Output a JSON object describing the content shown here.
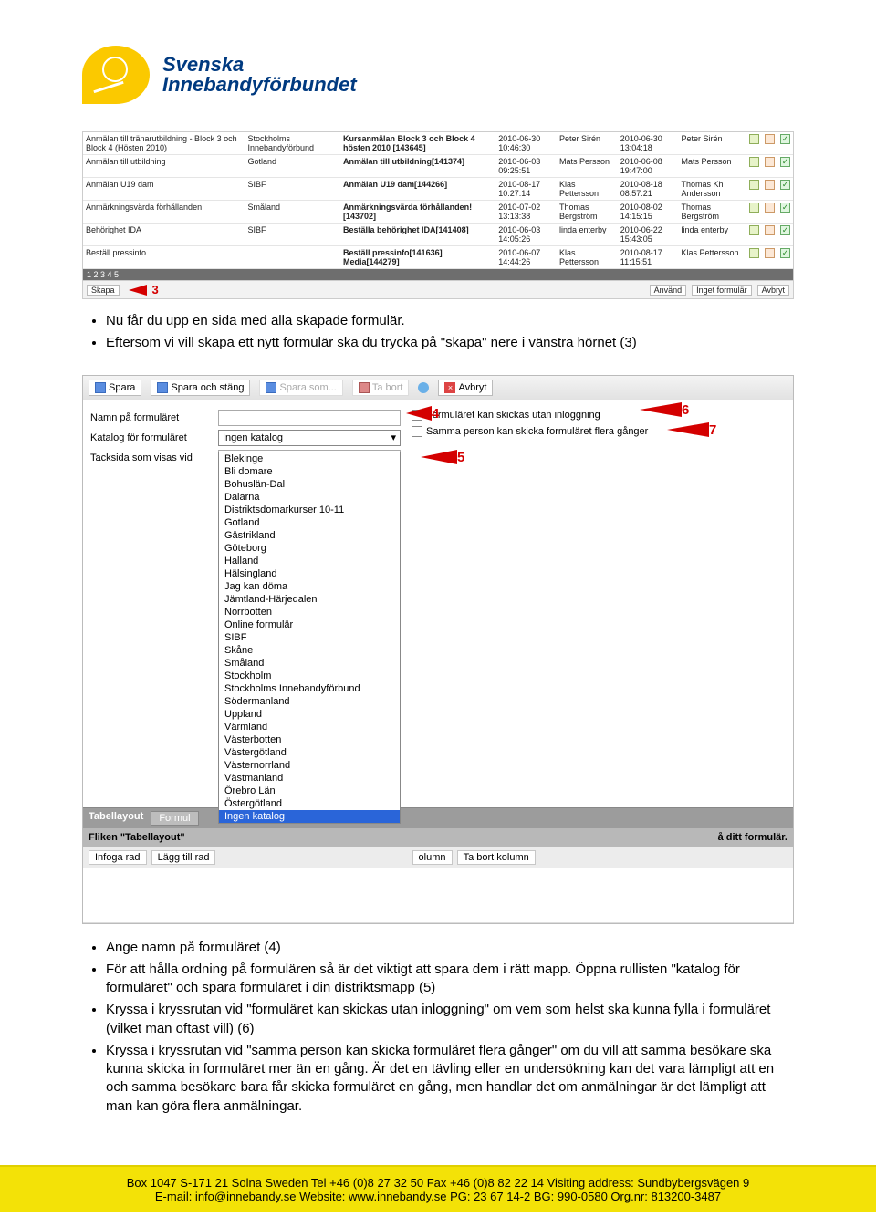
{
  "logo": {
    "line1": "Svenska",
    "line2": "Innebandyförbundet"
  },
  "table": {
    "rows": [
      {
        "c0": "Anmälan till tränarutbildning - Block 3 och Block 4 (Hösten 2010)",
        "c1": "Stockholms Innebandyförbund",
        "c2": "Kursanmälan Block 3 och Block 4 hösten 2010 [143645]",
        "c3": "2010-06-30 10:46:30",
        "c4": "Peter Sirén",
        "c5": "2010-06-30 13:04:18",
        "c6": "Peter Sirén"
      },
      {
        "c0": "Anmälan till utbildning",
        "c1": "Gotland",
        "c2": "Anmälan till utbildning[141374]",
        "c3": "2010-06-03 09:25:51",
        "c4": "Mats Persson",
        "c5": "2010-06-08 19:47:00",
        "c6": "Mats Persson"
      },
      {
        "c0": "Anmälan U19 dam",
        "c1": "SIBF",
        "c2": "Anmälan U19 dam[144266]",
        "c3": "2010-08-17 10:27:14",
        "c4": "Klas Pettersson",
        "c5": "2010-08-18 08:57:21",
        "c6": "Thomas Kh Andersson"
      },
      {
        "c0": "Anmärkningsvärda förhållanden",
        "c1": "Småland",
        "c2": "Anmärkningsvärda förhållanden![143702]",
        "c3": "2010-07-02 13:13:38",
        "c4": "Thomas Bergström",
        "c5": "2010-08-02 14:15:15",
        "c6": "Thomas Bergström"
      },
      {
        "c0": "Behörighet IDA",
        "c1": "SIBF",
        "c2": "Beställa behörighet IDA[141408]",
        "c3": "2010-06-03 14:05:26",
        "c4": "linda enterby",
        "c5": "2010-06-22 15:43:05",
        "c6": "linda enterby"
      },
      {
        "c0": "Beställ pressinfo",
        "c1": "",
        "c2": "Beställ pressinfo[141636] Media[144279]",
        "c3": "2010-06-07 14:44:26",
        "c4": "Klas Pettersson",
        "c5": "2010-08-17 11:15:51",
        "c6": "Klas Pettersson"
      }
    ],
    "pager": "1 2 3 4 5",
    "footer_left": "Skapa",
    "footer_right_use": "Använd",
    "footer_right_no": "Inget formulär",
    "footer_right_cancel": "Avbryt"
  },
  "ann3": "3",
  "bullets1": {
    "i0": "Nu får du upp en sida med alla skapade formulär.",
    "i1": "Eftersom vi vill skapa ett nytt formulär ska du trycka på \"skapa\" nere i vänstra hörnet (3)"
  },
  "toolbar": {
    "save": "Spara",
    "save_close": "Spara och stäng",
    "save_as": "Spara som...",
    "delete": "Ta bort",
    "cancel": "Avbryt"
  },
  "form": {
    "name_lbl": "Namn på formuläret",
    "folder_lbl": "Katalog för formuläret",
    "thanks_lbl": "Tacksida som visas vid",
    "folder_val": "Ingen katalog",
    "chk1": "Formuläret kan skickas utan inloggning",
    "chk2": "Samma person kan skicka formuläret flera gånger"
  },
  "ann4": "4",
  "ann5": "5",
  "ann6": "6",
  "ann7": "7",
  "dropdown": [
    "Blekinge",
    "Bli domare",
    "Bohuslän-Dal",
    "Dalarna",
    "Distriktsdomarkurser 10-11",
    "Gotland",
    "Gästrikland",
    "Göteborg",
    "Halland",
    "Hälsingland",
    "Jag kan döma",
    "Jämtland-Härjedalen",
    "Norrbotten",
    "Online formulär",
    "SIBF",
    "Skåne",
    "Småland",
    "Stockholm",
    "Stockholms Innebandyförbund",
    "Södermanland",
    "Uppland",
    "Värmland",
    "Västerbotten",
    "Västergötland",
    "Västernorrland",
    "Västmanland",
    "Örebro Län",
    "Östergötland",
    "Ingen katalog"
  ],
  "tabs": {
    "label": "Tabellayout",
    "t1": "Formul",
    "subline": "å ditt formulär.",
    "subtitle": "Fliken \"Tabellayout\""
  },
  "cmds": {
    "c0": "Infoga rad",
    "c1": "Lägg till rad",
    "c2": "olumn",
    "c3": "Ta bort kolumn"
  },
  "bullets2": {
    "i0": "Ange namn på formuläret (4)",
    "i1": "För att hålla ordning på formulären så är det viktigt att spara dem i rätt mapp. Öppna rullisten \"katalog för formuläret\" och spara formuläret i din distriktsmapp (5)",
    "i2": "Kryssa i kryssrutan vid \"formuläret kan skickas utan inloggning\" om vem som helst ska kunna fylla i formuläret (vilket man oftast vill) (6)",
    "i3": "Kryssa i kryssrutan vid \"samma person kan skicka formuläret flera gånger\" om du vill att samma besökare ska kunna skicka in formuläret mer än en gång. Är det en tävling eller en undersökning kan det vara lämpligt att en och samma besökare bara får skicka formuläret en gång, men handlar det om anmälningar är det lämpligt att man kan göra flera anmälningar."
  },
  "footer": {
    "l1": "Box 1047 S-171 21 Solna Sweden  Tel +46 (0)8 27 32 50 Fax +46 (0)8 82 22 14 Visiting address: Sundbybergsvägen 9",
    "l2": "E-mail: info@innebandy.se Website: www.innebandy.se  PG: 23 67 14-2 BG: 990-0580 Org.nr: 813200-3487"
  }
}
